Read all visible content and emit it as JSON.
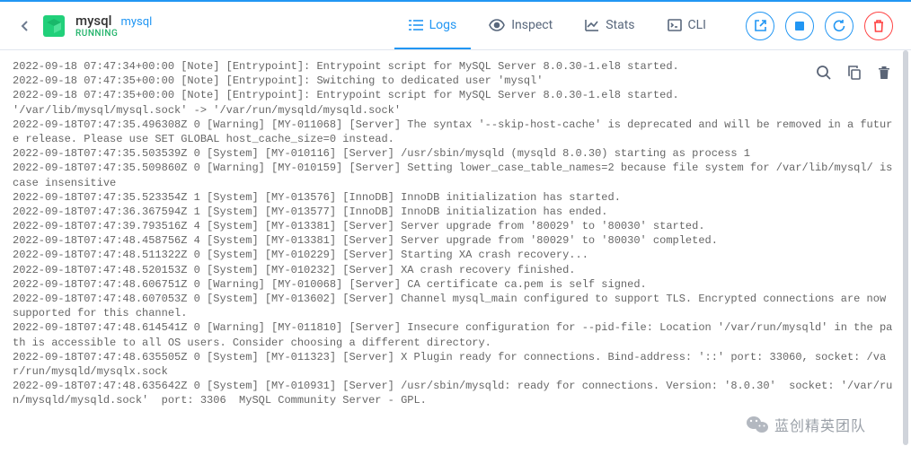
{
  "header": {
    "title": "mysql",
    "image_name": "mysql",
    "status": "RUNNING"
  },
  "tabs": {
    "logs": "Logs",
    "inspect": "Inspect",
    "stats": "Stats",
    "cli": "CLI"
  },
  "logs_text": "2022-09-18 07:47:34+00:00 [Note] [Entrypoint]: Entrypoint script for MySQL Server 8.0.30-1.el8 started.\n2022-09-18 07:47:35+00:00 [Note] [Entrypoint]: Switching to dedicated user 'mysql'\n2022-09-18 07:47:35+00:00 [Note] [Entrypoint]: Entrypoint script for MySQL Server 8.0.30-1.el8 started.\n'/var/lib/mysql/mysql.sock' -> '/var/run/mysqld/mysqld.sock'\n2022-09-18T07:47:35.496308Z 0 [Warning] [MY-011068] [Server] The syntax '--skip-host-cache' is deprecated and will be removed in a future release. Please use SET GLOBAL host_cache_size=0 instead.\n2022-09-18T07:47:35.503539Z 0 [System] [MY-010116] [Server] /usr/sbin/mysqld (mysqld 8.0.30) starting as process 1\n2022-09-18T07:47:35.509860Z 0 [Warning] [MY-010159] [Server] Setting lower_case_table_names=2 because file system for /var/lib/mysql/ is case insensitive\n2022-09-18T07:47:35.523354Z 1 [System] [MY-013576] [InnoDB] InnoDB initialization has started.\n2022-09-18T07:47:36.367594Z 1 [System] [MY-013577] [InnoDB] InnoDB initialization has ended.\n2022-09-18T07:47:39.793516Z 4 [System] [MY-013381] [Server] Server upgrade from '80029' to '80030' started.\n2022-09-18T07:47:48.458756Z 4 [System] [MY-013381] [Server] Server upgrade from '80029' to '80030' completed.\n2022-09-18T07:47:48.511322Z 0 [System] [MY-010229] [Server] Starting XA crash recovery...\n2022-09-18T07:47:48.520153Z 0 [System] [MY-010232] [Server] XA crash recovery finished.\n2022-09-18T07:47:48.606751Z 0 [Warning] [MY-010068] [Server] CA certificate ca.pem is self signed.\n2022-09-18T07:47:48.607053Z 0 [System] [MY-013602] [Server] Channel mysql_main configured to support TLS. Encrypted connections are now supported for this channel.\n2022-09-18T07:47:48.614541Z 0 [Warning] [MY-011810] [Server] Insecure configuration for --pid-file: Location '/var/run/mysqld' in the path is accessible to all OS users. Consider choosing a different directory.\n2022-09-18T07:47:48.635505Z 0 [System] [MY-011323] [Server] X Plugin ready for connections. Bind-address: '::' port: 33060, socket: /var/run/mysqld/mysqlx.sock\n2022-09-18T07:47:48.635642Z 0 [System] [MY-010931] [Server] /usr/sbin/mysqld: ready for connections. Version: '8.0.30'  socket: '/var/run/mysqld/mysqld.sock'  port: 3306  MySQL Community Server - GPL.",
  "watermark": "蓝创精英团队"
}
